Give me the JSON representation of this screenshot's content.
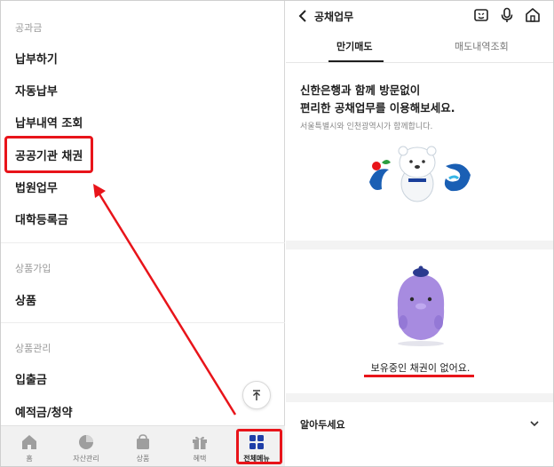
{
  "left_menu": {
    "sections": [
      {
        "title": "공과금",
        "items": [
          "납부하기",
          "자동납부",
          "납부내역 조회",
          "공공기관 채권",
          "법원업무",
          "대학등록금"
        ]
      },
      {
        "title": "상품가입",
        "items": [
          "상품"
        ]
      },
      {
        "title": "상품관리",
        "items": [
          "입출금",
          "예적금/청약"
        ]
      }
    ],
    "highlighted_item": "공공기관 채권"
  },
  "bottom_tabs": [
    {
      "label": "홈",
      "icon": "home-icon"
    },
    {
      "label": "자산관리",
      "icon": "pie-chart-icon"
    },
    {
      "label": "상품",
      "icon": "shopping-bag-icon"
    },
    {
      "label": "혜택",
      "icon": "gift-icon"
    },
    {
      "label": "전체메뉴",
      "icon": "grid-menu-icon",
      "active": true
    }
  ],
  "right_panel": {
    "header": {
      "title": "공채업무"
    },
    "tabs": [
      {
        "label": "만기매도",
        "active": true
      },
      {
        "label": "매도내역조회",
        "active": false
      }
    ],
    "promo": {
      "line1": "신한은행과 함께 방문없이",
      "line2": "편리한 공채업무를 이용해보세요.",
      "subtitle": "서울특별시와 인천광역시가 함께합니다."
    },
    "empty_message": "보유중인 채권이 없어요.",
    "notice": {
      "label": "알아두세요"
    }
  },
  "colors": {
    "highlight_red": "#e8141a",
    "active_tab_blue": "#1f3fa8",
    "mascot_purple": "#a78be0"
  }
}
